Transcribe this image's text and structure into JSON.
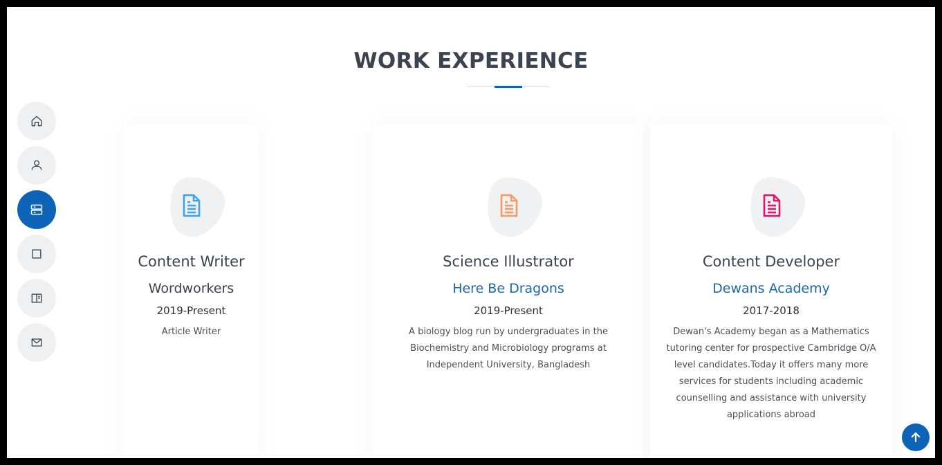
{
  "section": {
    "title": "WORK EXPERIENCE"
  },
  "nav": {
    "items": [
      {
        "icon": "home-icon",
        "active": false
      },
      {
        "icon": "user-icon",
        "active": false
      },
      {
        "icon": "server-icon",
        "active": true
      },
      {
        "icon": "square-icon",
        "active": false
      },
      {
        "icon": "book-icon",
        "active": false
      },
      {
        "icon": "envelope-icon",
        "active": false
      }
    ]
  },
  "experience": [
    {
      "role": "Content Writer",
      "organization": "Wordworkers",
      "period": "2019-Present",
      "description": "Article Writer",
      "icon": "document-icon",
      "icon_color": "#3da3f0",
      "org_color": "#3b4351"
    },
    {
      "role": "Science Illustrator",
      "organization": "Here Be Dragons",
      "period": "2019-Present",
      "description": "A biology blog run by undergraduates in the Biochemistry and Microbiology programs at Independent University, Bangladesh",
      "icon": "document-icon",
      "icon_color": "#f79a63",
      "org_color": "#1a66b0"
    },
    {
      "role": "Content Developer",
      "organization": "Dewans Academy",
      "period": "2017-2018",
      "description": "Dewan's Academy began as a Mathematics tutoring center for prospective Cambridge O/A level candidates.Today it offers many more services for students including academic counselling and assistance with university applications abroad",
      "icon": "document-icon",
      "icon_color": "#e5156b",
      "org_color": "#1a66b0"
    }
  ],
  "colors": {
    "accent": "#0d63b6",
    "nav_bg": "#eef0f2",
    "heading": "#3b4351"
  },
  "back_to_top": {
    "icon": "arrow-up-icon"
  }
}
